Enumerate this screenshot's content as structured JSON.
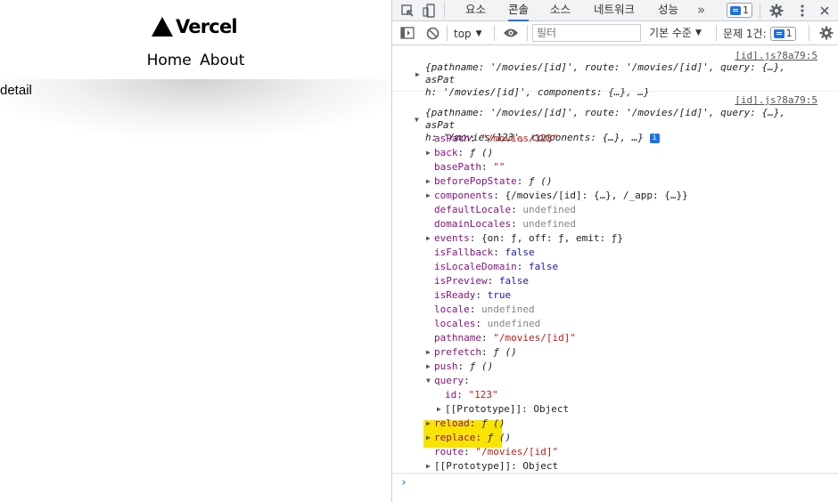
{
  "page": {
    "logo_text": "Vercel",
    "nav": [
      "Home",
      "About"
    ],
    "body_text": "detail"
  },
  "devtools": {
    "tabs": [
      "요소",
      "콘솔",
      "소스",
      "네트워크",
      "성능"
    ],
    "active_tab": "콘솔",
    "more_tabs_glyph": "»",
    "issues_badge_count": "1",
    "toolbar": {
      "context": "top",
      "filter_placeholder": "필터",
      "log_level": "기본 수준",
      "issues_label": "문제 1건:",
      "issues_count": "1"
    },
    "console": {
      "msg1": {
        "source": "[id].js?8a79:5",
        "line1": "{pathname: '/movies/[id]', route: '/movies/[id]', query: {…}, asPat",
        "line2": "h: '/movies/[id]', components: {…}, …}"
      },
      "msg2": {
        "source": "[id].js?8a79:5",
        "line1": "{pathname: '/movies/[id]', route: '/movies/[id]', query: {…}, asPat",
        "line2": "h: '/movies/123', components: {…}, …}",
        "props": [
          {
            "key": "asPath",
            "value": "\"/movies/123\"",
            "kind": "str",
            "expandable": false
          },
          {
            "key": "back",
            "value": "ƒ ()",
            "kind": "fn",
            "expandable": true
          },
          {
            "key": "basePath",
            "value": "\"\"",
            "kind": "str",
            "expandable": false
          },
          {
            "key": "beforePopState",
            "value": "ƒ ()",
            "kind": "fn",
            "expandable": true
          },
          {
            "key": "components",
            "value": "{/movies/[id]: {…}, /_app: {…}}",
            "kind": "obj",
            "expandable": true
          },
          {
            "key": "defaultLocale",
            "value": "undefined",
            "kind": "und",
            "expandable": false
          },
          {
            "key": "domainLocales",
            "value": "undefined",
            "kind": "und",
            "expandable": false
          },
          {
            "key": "events",
            "value": "{on: ƒ, off: ƒ, emit: ƒ}",
            "kind": "obj",
            "expandable": true
          },
          {
            "key": "isFallback",
            "value": "false",
            "kind": "kw",
            "expandable": false
          },
          {
            "key": "isLocaleDomain",
            "value": "false",
            "kind": "kw",
            "expandable": false
          },
          {
            "key": "isPreview",
            "value": "false",
            "kind": "kw",
            "expandable": false
          },
          {
            "key": "isReady",
            "value": "true",
            "kind": "kw",
            "expandable": false
          },
          {
            "key": "locale",
            "value": "undefined",
            "kind": "und",
            "expandable": false
          },
          {
            "key": "locales",
            "value": "undefined",
            "kind": "und",
            "expandable": false
          },
          {
            "key": "pathname",
            "value": "\"/movies/[id]\"",
            "kind": "str",
            "expandable": false
          },
          {
            "key": "prefetch",
            "value": "ƒ ()",
            "kind": "fn",
            "expandable": true
          },
          {
            "key": "push",
            "value": "ƒ ()",
            "kind": "fn",
            "expandable": true
          },
          {
            "key": "query",
            "value": "",
            "kind": "obj",
            "expandable": true,
            "expanded": true
          },
          {
            "key": "id",
            "value": "\"123\"",
            "kind": "str",
            "expandable": false,
            "nested": true
          },
          {
            "key": "[[Prototype]]",
            "value": "Object",
            "kind": "plain",
            "expandable": true,
            "nested": true
          },
          {
            "key": "reload",
            "value": "ƒ ()",
            "kind": "fn",
            "expandable": true
          },
          {
            "key": "replace",
            "value": "ƒ ()",
            "kind": "fn",
            "expandable": true
          },
          {
            "key": "route",
            "value": "\"/movies/[id]\"",
            "kind": "str",
            "expandable": false
          },
          {
            "key": "[[Prototype]]",
            "value": "Object",
            "kind": "plain",
            "expandable": true
          }
        ]
      },
      "prompt": "›"
    }
  },
  "colors": {
    "highlight": "#f9e300",
    "accent": "#1a73e8",
    "key": "#881280",
    "string": "#c41a16",
    "keyword": "#1a1aa6"
  }
}
